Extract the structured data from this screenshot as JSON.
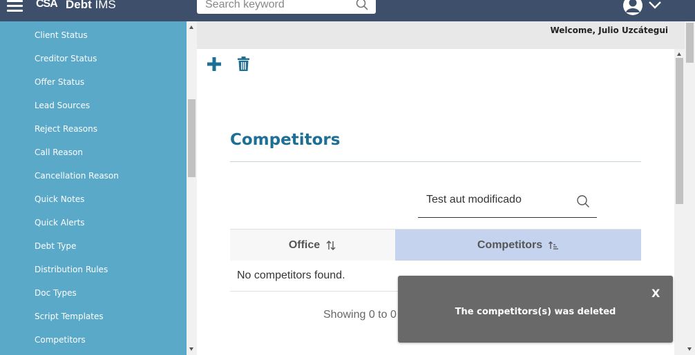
{
  "header": {
    "logo_mark": "CSA",
    "app_title_bold": "Debt",
    "app_title_rest": " IMS",
    "search_placeholder": "Search keyword",
    "colors": {
      "topbar": "#3d4f6b"
    }
  },
  "sidebar": {
    "items": [
      {
        "label": "Client Status"
      },
      {
        "label": "Creditor Status"
      },
      {
        "label": "Offer Status"
      },
      {
        "label": "Lead Sources"
      },
      {
        "label": "Reject Reasons"
      },
      {
        "label": "Call Reason"
      },
      {
        "label": "Cancellation Reason"
      },
      {
        "label": "Quick Notes"
      },
      {
        "label": "Quick Alerts"
      },
      {
        "label": "Debt Type"
      },
      {
        "label": "Distribution Rules"
      },
      {
        "label": "Doc Types"
      },
      {
        "label": "Script Templates"
      },
      {
        "label": "Competitors"
      }
    ],
    "colors": {
      "background": "#5aa9c9"
    }
  },
  "main": {
    "welcome": "Welcome, Julio Uzcátegui",
    "toolbar": {
      "add_icon": "plus-icon",
      "delete_icon": "trash-icon"
    },
    "title": "Competitors",
    "filter_value": "Test aut modificado",
    "table": {
      "columns": [
        {
          "label": "Office",
          "sort": "unsorted"
        },
        {
          "label": "Competitors",
          "sort": "ascending"
        }
      ],
      "empty_message": "No competitors found."
    },
    "paging": "Showing 0 to 0"
  },
  "toast": {
    "close_label": "X",
    "message": "The competitors(s) was deleted"
  }
}
